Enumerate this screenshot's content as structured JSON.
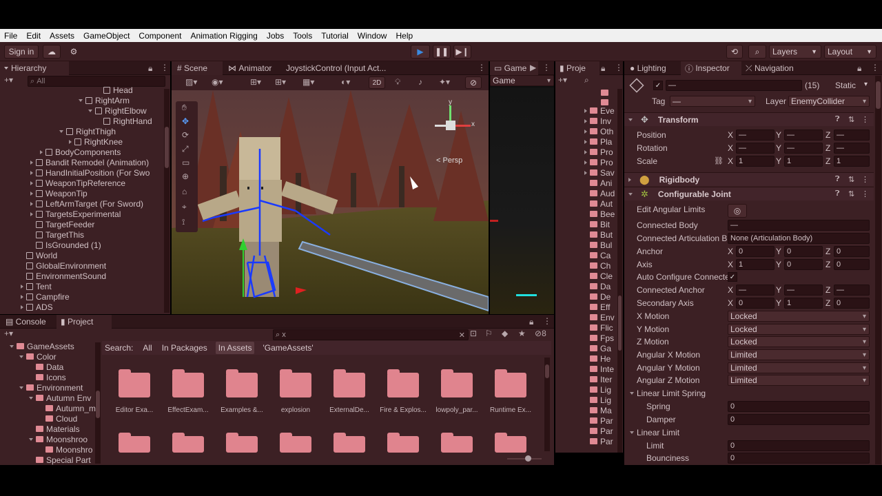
{
  "menu": [
    "File",
    "Edit",
    "Assets",
    "GameObject",
    "Component",
    "Animation Rigging",
    "Jobs",
    "Tools",
    "Tutorial",
    "Window",
    "Help"
  ],
  "toolbar": {
    "sign_in": "Sign in",
    "layers": "Layers",
    "layout": "Layout"
  },
  "hierarchy": {
    "tab": "Hierarchy",
    "search_placeholder": "All",
    "items": [
      {
        "label": "Head",
        "indent": 10,
        "type": "cube",
        "arrow": "none"
      },
      {
        "label": "RightArm",
        "indent": 8,
        "type": "cube",
        "arrow": "down"
      },
      {
        "label": "RightElbow",
        "indent": 9,
        "type": "cube",
        "arrow": "down"
      },
      {
        "label": "RightHand",
        "indent": 10,
        "type": "cube",
        "arrow": "none"
      },
      {
        "label": "RightThigh",
        "indent": 6,
        "type": "cube",
        "arrow": "down"
      },
      {
        "label": "RightKnee",
        "indent": 7,
        "type": "cube",
        "arrow": "right"
      },
      {
        "label": "BodyComponents",
        "indent": 4,
        "type": "cube",
        "arrow": "right"
      },
      {
        "label": "Bandit Remodel (Animation)",
        "indent": 3,
        "type": "cube",
        "arrow": "right"
      },
      {
        "label": "HandInitialPosition (For Swo",
        "indent": 3,
        "type": "cube",
        "arrow": "right"
      },
      {
        "label": "WeaponTipReference",
        "indent": 3,
        "type": "cube",
        "arrow": "right"
      },
      {
        "label": "WeaponTip",
        "indent": 3,
        "type": "cube",
        "arrow": "right"
      },
      {
        "label": "LeftArmTarget (For Sword)",
        "indent": 3,
        "type": "cube",
        "arrow": "right"
      },
      {
        "label": "TargetsExperimental",
        "indent": 3,
        "type": "cube",
        "arrow": "right"
      },
      {
        "label": "TargetFeeder",
        "indent": 3,
        "type": "cube",
        "arrow": "none"
      },
      {
        "label": "TargetThis",
        "indent": 3,
        "type": "cube",
        "arrow": "none"
      },
      {
        "label": "IsGrounded (1)",
        "indent": 3,
        "type": "cube",
        "arrow": "none"
      },
      {
        "label": "World",
        "indent": 2,
        "type": "cube",
        "arrow": "none"
      },
      {
        "label": "GlobalEnvironment",
        "indent": 2,
        "type": "cube",
        "arrow": "none"
      },
      {
        "label": "EnvironmentSound",
        "indent": 2,
        "type": "cube",
        "arrow": "none"
      },
      {
        "label": "Tent",
        "indent": 2,
        "type": "cube",
        "arrow": "right"
      },
      {
        "label": "Campfire",
        "indent": 2,
        "type": "cube",
        "arrow": "right"
      },
      {
        "label": "ADS",
        "indent": 2,
        "type": "cube",
        "arrow": "right"
      }
    ]
  },
  "scene": {
    "tabs": [
      "Scene",
      "Animator",
      "JoystickControl (Input Act..."
    ],
    "mode_2d": "2D",
    "persp": "Persp",
    "gizmo_y": "y",
    "gizmo_x": "x"
  },
  "game": {
    "tab": "Game",
    "dropdown": "Game"
  },
  "project_tab_small": "Proje",
  "project_small_items": [
    "Eve",
    "Inv",
    "Oth",
    "Pla",
    "Pro",
    "Pro",
    "Sav",
    "Ani",
    "Aud",
    "Aut",
    "Bee",
    "Bit",
    "But",
    "Bul",
    "Ca",
    "Ch",
    "Cle",
    "Da",
    "De",
    "Eff",
    "Env",
    "Flic",
    "Fps",
    "Ga",
    "He",
    "Inte",
    "Iter",
    "Lig",
    "Lig",
    "Ma",
    "Par",
    "Par",
    "Par"
  ],
  "bottom": {
    "tabs": [
      "Console",
      "Project"
    ],
    "search_value": "x",
    "count": "8",
    "filter": {
      "search_label": "Search:",
      "all": "All",
      "in_packages": "In Packages",
      "in_assets": "In Assets",
      "game_assets": "'GameAssets'"
    },
    "tree": [
      {
        "label": "GameAssets",
        "indent": 1,
        "arrow": "down"
      },
      {
        "label": "Color",
        "indent": 2,
        "arrow": "down"
      },
      {
        "label": "Data",
        "indent": 3,
        "arrow": "none"
      },
      {
        "label": "Icons",
        "indent": 3,
        "arrow": "none"
      },
      {
        "label": "Environment",
        "indent": 2,
        "arrow": "down"
      },
      {
        "label": "Autumn Env",
        "indent": 3,
        "arrow": "down"
      },
      {
        "label": "Autumn_m",
        "indent": 4,
        "arrow": "none"
      },
      {
        "label": "Cloud",
        "indent": 4,
        "arrow": "none"
      },
      {
        "label": "Materials",
        "indent": 3,
        "arrow": "none"
      },
      {
        "label": "Moonshroo",
        "indent": 3,
        "arrow": "down"
      },
      {
        "label": "Moonshro",
        "indent": 4,
        "arrow": "none"
      },
      {
        "label": "Special Part",
        "indent": 3,
        "arrow": "none"
      }
    ],
    "folders": [
      "Editor Exa...",
      "EffectExam...",
      "Examples &...",
      "explosion",
      "ExternalDe...",
      "Fire & Explos...",
      "lowpoly_par...",
      "Runtime Ex..."
    ]
  },
  "inspector": {
    "tabs": [
      "Lighting",
      "Inspector",
      "Navigation"
    ],
    "count": "(15)",
    "static_label": "Static",
    "tag_label": "Tag",
    "tag_value": "—",
    "layer_label": "Layer",
    "layer_value": "EnemyCollider",
    "transform": {
      "title": "Transform",
      "position_label": "Position",
      "rotation_label": "Rotation",
      "scale_label": "Scale",
      "position": [
        "—",
        "—",
        "—"
      ],
      "rotation": [
        "—",
        "—",
        "—"
      ],
      "scale": [
        "1",
        "1",
        "1"
      ]
    },
    "rigidbody_title": "Rigidbody",
    "joint": {
      "title": "Configurable Joint",
      "edit_angular_limits": "Edit Angular Limits",
      "connected_body_label": "Connected Body",
      "connected_body_value": "—",
      "connected_art_label": "Connected Articulation B",
      "connected_art_value": "None (Articulation Body)",
      "anchor_label": "Anchor",
      "anchor": [
        "0",
        "0",
        "0"
      ],
      "axis_label": "Axis",
      "axis": [
        "1",
        "0",
        "0"
      ],
      "auto_configure_label": "Auto Configure Connecte",
      "connected_anchor_label": "Connected Anchor",
      "connected_anchor": [
        "—",
        "—",
        "—"
      ],
      "secondary_axis_label": "Secondary Axis",
      "secondary_axis": [
        "0",
        "1",
        "0"
      ],
      "x_motion_label": "X Motion",
      "x_motion": "Locked",
      "y_motion_label": "Y Motion",
      "y_motion": "Locked",
      "z_motion_label": "Z Motion",
      "z_motion": "Locked",
      "ax_motion_label": "Angular X Motion",
      "ax_motion": "Limited",
      "ay_motion_label": "Angular Y Motion",
      "ay_motion": "Limited",
      "az_motion_label": "Angular Z Motion",
      "az_motion": "Limited",
      "lls_label": "Linear Limit Spring",
      "spring_label": "Spring",
      "spring": "0",
      "damper_label": "Damper",
      "damper": "0",
      "ll_label": "Linear Limit",
      "limit_label": "Limit",
      "limit": "0",
      "bounciness_label": "Bounciness",
      "bounciness": "0"
    },
    "axis_letters": {
      "x": "X",
      "y": "Y",
      "z": "Z"
    }
  },
  "colors": {
    "panel": "#3c2024",
    "accent_blue": "#3a7bd5",
    "folder": "#e0848e"
  }
}
